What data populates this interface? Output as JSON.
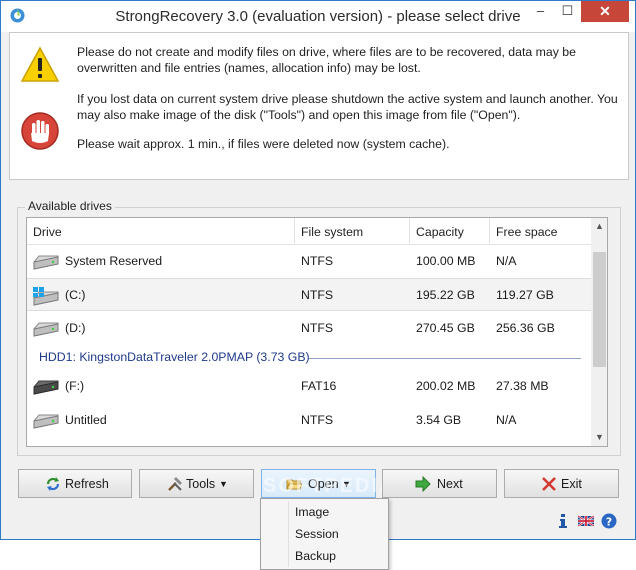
{
  "window": {
    "title": "StrongRecovery 3.0 (evaluation version) - please select drive",
    "minimize": "–",
    "maximize": "☐",
    "close": "✕"
  },
  "notice": {
    "line1": "Please do not create and modify files on drive, where files are to be recovered, data may be overwritten and file entries (names, allocation info) may be lost.",
    "line2": "If you lost data on current system drive please shutdown the active system and launch another. You may also make image of the disk (\"Tools\") and open this image from file (\"Open\").",
    "line3": "Please wait approx. 1 min., if files were deleted now (system cache).",
    "icons": [
      "warning-icon",
      "stop-hand-icon"
    ]
  },
  "drives": {
    "group_label": "Available drives",
    "columns": [
      "Drive",
      "File system",
      "Capacity",
      "Free space"
    ],
    "rows": [
      {
        "name": "System Reserved",
        "fs": "NTFS",
        "capacity": "100.00 MB",
        "free": "N/A"
      },
      {
        "name": "(C:)",
        "fs": "NTFS",
        "capacity": "195.22 GB",
        "free": "119.27 GB"
      },
      {
        "name": "(D:)",
        "fs": "NTFS",
        "capacity": "270.45 GB",
        "free": "256.36 GB"
      },
      {
        "name": "(F:)",
        "fs": "FAT16",
        "capacity": "200.02 MB",
        "free": "27.38 MB"
      },
      {
        "name": "Untitled",
        "fs": "NTFS",
        "capacity": "3.54 GB",
        "free": "N/A"
      }
    ],
    "group_header": "HDD1: KingstonDataTraveler 2.0PMAP (3.73 GB)",
    "selected_row": "(C:)"
  },
  "buttons": {
    "refresh": "Refresh",
    "tools": "Tools",
    "open": "Open",
    "next": "Next",
    "exit": "Exit"
  },
  "open_menu": {
    "items": [
      "Image",
      "Session",
      "Backup"
    ]
  },
  "watermark": "SOFTPEDIA",
  "status_icons": [
    "info-icon",
    "uk-flag-icon",
    "help-icon"
  ],
  "colors": {
    "title_bar": "#ffffff",
    "window_border": "#2f79c9",
    "close_button": "#c7463a",
    "group_header": "#1e3a8a"
  }
}
